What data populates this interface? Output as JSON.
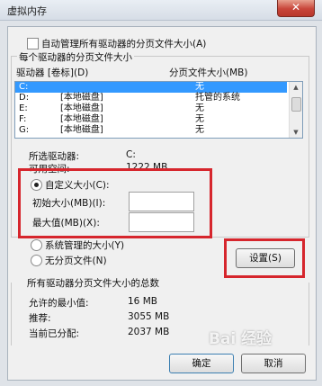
{
  "window": {
    "title": "虚拟内存",
    "close": "✕"
  },
  "auto_manage": {
    "label": "自动管理所有驱动器的分页文件大小(A)"
  },
  "group_each": {
    "title": "每个驱动器的分页文件大小",
    "col_drive": "驱动器 [卷标](D)",
    "col_size": "分页文件大小(MB)"
  },
  "drives": [
    {
      "drive": "C:",
      "label": "",
      "size": "无",
      "selected": true
    },
    {
      "drive": "D:",
      "label": "[本地磁盘]",
      "size": "托管的系统",
      "selected": false
    },
    {
      "drive": "E:",
      "label": "[本地磁盘]",
      "size": "无",
      "selected": false
    },
    {
      "drive": "F:",
      "label": "[本地磁盘]",
      "size": "无",
      "selected": false
    },
    {
      "drive": "G:",
      "label": "[本地磁盘]",
      "size": "无",
      "selected": false
    }
  ],
  "selected_drive": {
    "label": "所选驱动器:",
    "value": "C:"
  },
  "available_space": {
    "label": "可用空间:",
    "value": "1222 MB"
  },
  "custom_size": {
    "label": "自定义大小(C):",
    "initial_label": "初始大小(MB)(I):",
    "initial_value": "",
    "max_label": "最大值(MB)(X):",
    "max_value": ""
  },
  "system_managed": {
    "label": "系统管理的大小(Y)"
  },
  "no_paging": {
    "label": "无分页文件(N)"
  },
  "set_button": "设置(S)",
  "totals": {
    "title": "所有驱动器分页文件大小的总数",
    "min_label": "允许的最小值:",
    "min_value": "16 MB",
    "rec_label": "推荐:",
    "rec_value": "3055 MB",
    "cur_label": "当前已分配:",
    "cur_value": "2037 MB"
  },
  "ok_button": "确定",
  "cancel_button": "取消",
  "watermark": "Bai 经验",
  "colors": {
    "highlight": "#d6262d",
    "selection": "#3399ff"
  }
}
